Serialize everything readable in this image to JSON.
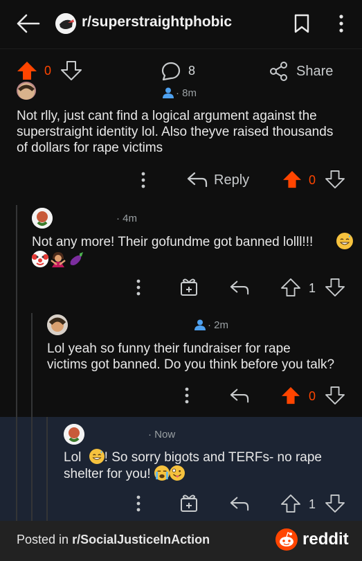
{
  "header": {
    "subreddit": "r/superstraightphobic"
  },
  "post_actions": {
    "vote_count": "0",
    "comment_count": "8",
    "share_label": "Share"
  },
  "comments": [
    {
      "age": "8m",
      "text_lines": [
        "Not rlly, just cant find a logical argument against the",
        "superstraight identity lol. Also theyve raised thousands",
        "of dollars for rape victims"
      ],
      "reply_label": "Reply",
      "score": "0",
      "upvoted": true
    },
    {
      "age": "4m",
      "text_lines": [
        "Not any more! Their gofundme got banned lolll!!!"
      ],
      "emojis": [
        "grinning-sweat-emoji",
        "clown-emoji",
        "woman-gesturing-emoji",
        "eggplant-emoji"
      ],
      "score": "1",
      "upvoted": false
    },
    {
      "age": "2m",
      "text_lines": [
        "Lol yeah so funny their fundraiser for rape",
        "victims got banned. Do you think before you talk?"
      ],
      "score": "0",
      "upvoted": true
    },
    {
      "age": "Now",
      "text_lines": [
        "Lol",
        "! So sorry bigots and TERFs- no rape",
        "shelter for you!"
      ],
      "emojis": [
        "grinning-sweat-emoji",
        "crying-emoji",
        "zany-face-emoji"
      ],
      "score": "1",
      "upvoted": false
    }
  ],
  "footer": {
    "posted_in_prefix": "Posted in ",
    "subreddit": "r/SocialJusticeInAction",
    "brand": "reddit"
  },
  "colors": {
    "upvote": "#ff4500",
    "background": "#0f0f0f",
    "highlight": "#1c2433",
    "footer": "#222222"
  },
  "icons": [
    "back-arrow-icon",
    "bookmark-icon",
    "kebab-icon",
    "upvote-icon",
    "downvote-icon",
    "comment-icon",
    "share-icon",
    "reply-icon",
    "award-icon",
    "person-icon",
    "reddit-logo-icon"
  ]
}
